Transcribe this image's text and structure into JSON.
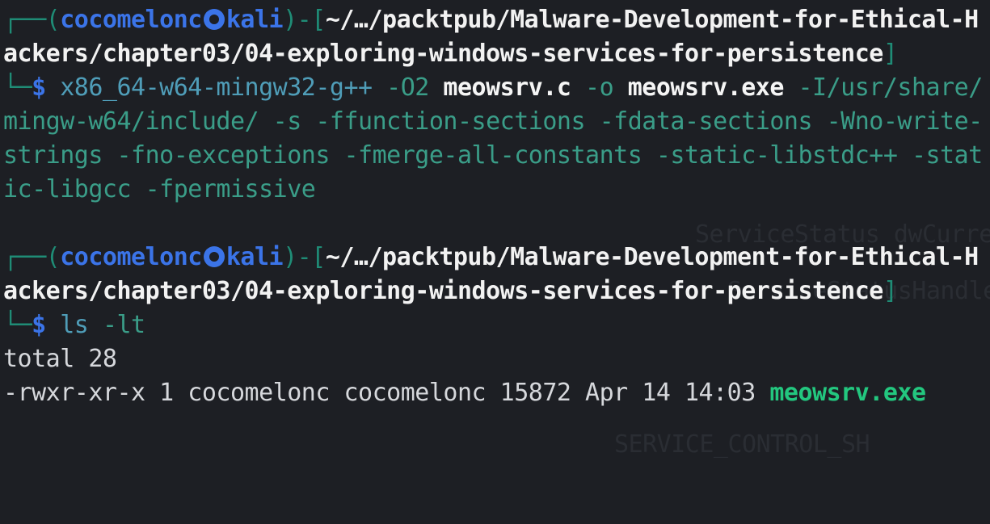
{
  "terminal": {
    "prompt1": {
      "open": "┌──(",
      "user": "cocomelonc",
      "host": "kali",
      "mid": ")-[",
      "path_line1": "~/…/packtpub/Malware-Development-for-Ethical-H",
      "path_line2": "ackers/chapter03/04-exploring-windows-services-for-persistence",
      "close": "]",
      "corner": "└─",
      "symbol": "$"
    },
    "command1": {
      "compiler": "x86_64-w64-mingw32-g++",
      "opt": "-O2",
      "src": "meowsrv.c",
      "out_flag": "-o",
      "out": "meowsrv.exe",
      "include_a": "-I/usr/share/",
      "line2": "mingw-w64/include/ -s -ffunction-sections -fdata-sections -Wno-write-",
      "line3": "strings -fno-exceptions -fmerge-all-constants -static-libstdc++ -stat",
      "line4": "ic-libgcc -fpermissive"
    },
    "prompt2": {
      "open": "┌──(",
      "user": "cocomelonc",
      "host": "kali",
      "mid": ")-[",
      "path_line1": "~/…/packtpub/Malware-Development-for-Ethical-H",
      "path_line2": "ackers/chapter03/04-exploring-windows-services-for-persistence",
      "close": "]",
      "corner": "└─",
      "symbol": "$"
    },
    "command2": {
      "cmd": "ls",
      "flag": "-lt"
    },
    "output": {
      "total": "total 28",
      "file_meta": "-rwxr-xr-x 1 cocomelonc cocomelonc 15872 Apr 14 14:03 ",
      "file_name": "meowsrv.exe"
    }
  },
  "colors": {
    "background": "#1d1f24",
    "frame": "#1f8c76",
    "user": "#3b74e8",
    "executable": "#23c77f"
  }
}
